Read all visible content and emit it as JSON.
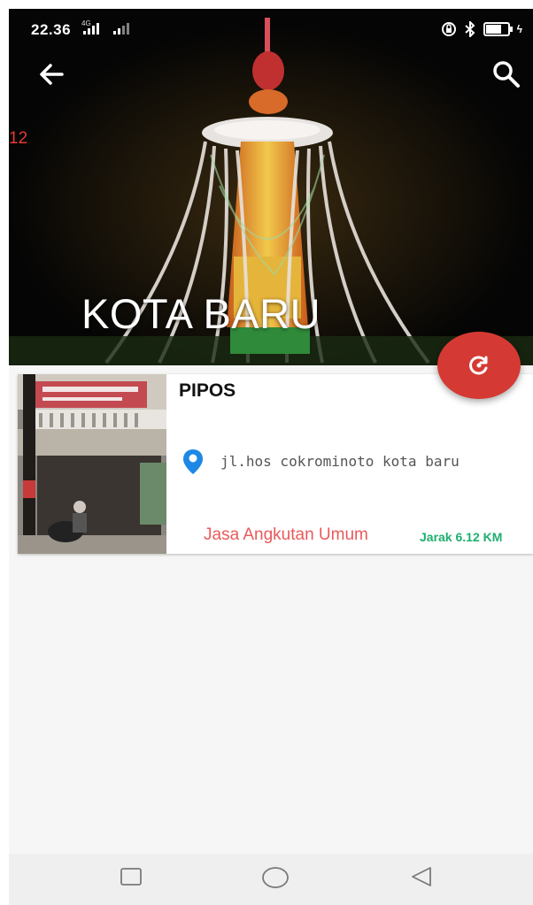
{
  "status_bar": {
    "time": "22.36",
    "network": "4G"
  },
  "header": {
    "back_icon": "arrow-left-icon",
    "search_icon": "search-icon",
    "side_count": "12",
    "title": "KOTA BARU"
  },
  "fab": {
    "icon": "refresh-icon",
    "color": "#d43a33"
  },
  "listing": {
    "name": "PIPOS",
    "address": "jl.hos cokrominoto kota baru",
    "category": "Jasa Angkutan Umum",
    "distance": "Jarak 6.12 KM",
    "colors": {
      "category": "#e95a5a",
      "distance": "#1fae6f",
      "pin": "#1e88e5"
    }
  },
  "nav_bar": {
    "recent_icon": "square-icon",
    "home_icon": "circle-icon",
    "back_icon": "triangle-back-icon"
  }
}
